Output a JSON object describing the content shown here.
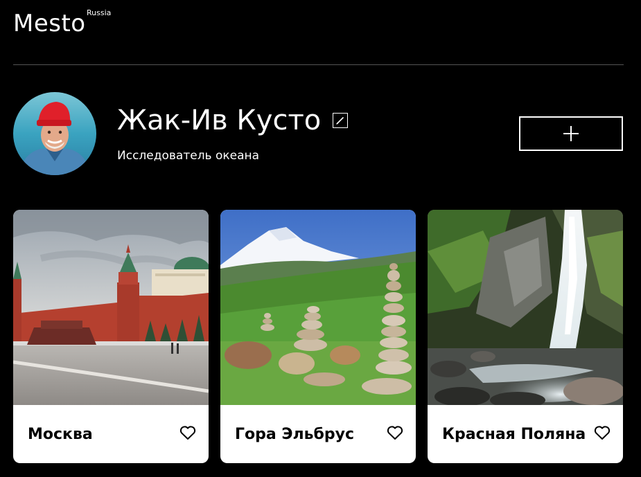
{
  "header": {
    "logo": "Mesto",
    "logo_sup": "Russia"
  },
  "profile": {
    "name": "Жак-Ив Кусто",
    "job": "Исследователь океана",
    "avatar_icon": "avatar-photo",
    "edit_icon": "pencil-icon",
    "add_icon": "plus-icon"
  },
  "cards": [
    {
      "title": "Москва",
      "image": "red-square-kremlin-photo",
      "like_icon": "heart-outline-icon"
    },
    {
      "title": "Гора Эльбрус",
      "image": "elbrus-mountain-stone-cairns-photo",
      "like_icon": "heart-outline-icon"
    },
    {
      "title": "Красная Поляна",
      "image": "waterfall-forest-photo",
      "like_icon": "heart-outline-icon"
    }
  ],
  "colors": {
    "background": "#000000",
    "text": "#ffffff",
    "card": "#ffffff",
    "divider": "#545454"
  }
}
